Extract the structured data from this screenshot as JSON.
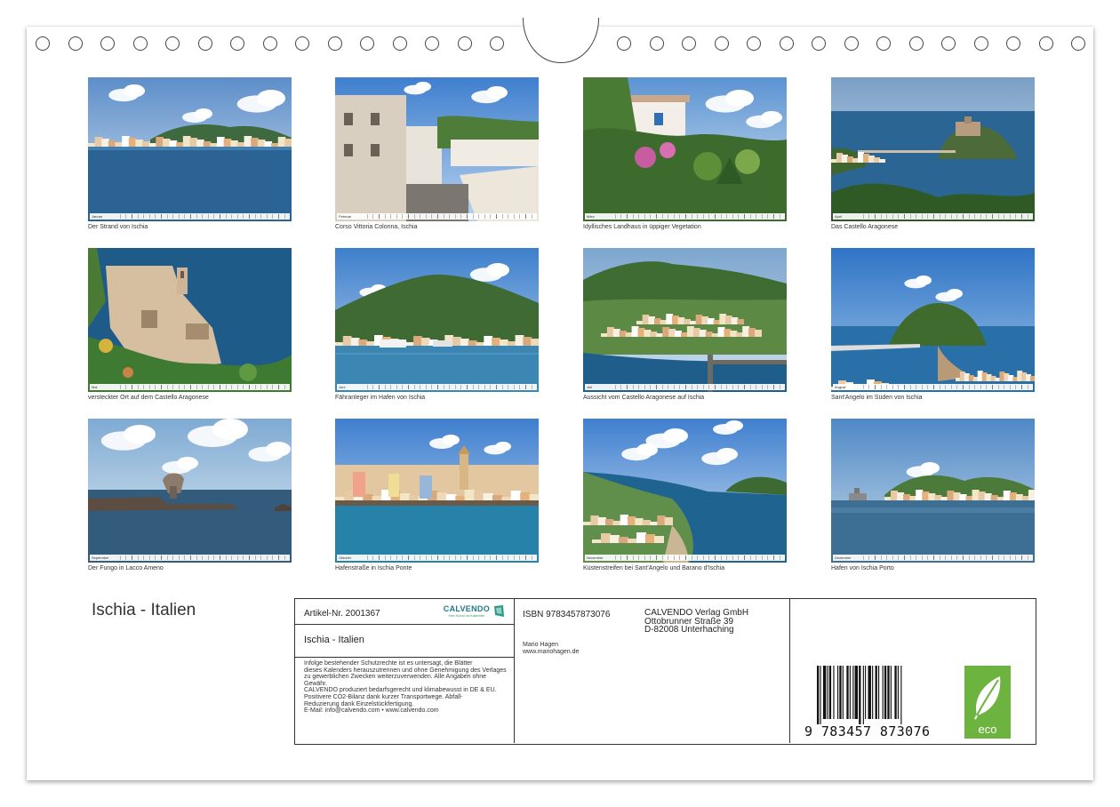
{
  "calendar": {
    "title": "Ischia - Italien",
    "months": [
      {
        "month": "Januar",
        "caption": "Der Strand von Ischia",
        "scene": "bay"
      },
      {
        "month": "Februar",
        "caption": "Corso Vittoria Colonna, Ischia",
        "scene": "street"
      },
      {
        "month": "März",
        "caption": "Idyllisches Landhaus in üppiger Vegetation",
        "scene": "garden"
      },
      {
        "month": "April",
        "caption": "Das Castello Aragonese",
        "scene": "castle"
      },
      {
        "month": "Mai",
        "caption": "versteckter Ort auf dem Castello Aragonese",
        "scene": "ruin"
      },
      {
        "month": "Juni",
        "caption": "Fähranleger im Hafen von Ischia",
        "scene": "harbor"
      },
      {
        "month": "Juli",
        "caption": "Aussicht vom Castello Aragonese auf Ischia",
        "scene": "town"
      },
      {
        "month": "August",
        "caption": "Sant'Angelo im Süden von Ischia",
        "scene": "santangelo"
      },
      {
        "month": "September",
        "caption": "Der Fungo in Lacco Ameno",
        "scene": "fungo"
      },
      {
        "month": "Oktober",
        "caption": "Hafenstraße in Ischia Ponte",
        "scene": "ponte"
      },
      {
        "month": "November",
        "caption": "Küstenstreifen bei Sant'Angelo und Barano d'Ischia",
        "scene": "coast"
      },
      {
        "month": "Dezember",
        "caption": "Hafen von Ischia Porto",
        "scene": "porto"
      }
    ]
  },
  "info": {
    "article": "Artikel-Nr. 2001367",
    "brand": "CALVENDO",
    "brand_sub": "Ihre Kunst im Kalender",
    "title": "Ischia - Italien",
    "legal": [
      "Infolge bestehender Schutzrechte ist es untersagt, die Blätter",
      "dieses Kalenders herauszutrennen und ohne Genehmigung des Verlages",
      "zu gewerblichen Zwecken weiterzuverwenden. Alle Angaben ohne",
      "Gewähr.",
      "CALVENDO produziert bedarfsgerecht und klimabewusst in DE & EU.",
      "Positivere CO2-Bilanz dank kurzer Transportwege. Abfall-",
      "Reduzierung dank Einzelstückfertigung.",
      "E-Mail: info@calvendo.com • www.calvendo.com"
    ],
    "isbn": "ISBN 9783457873076",
    "publisher": [
      "CALVENDO Verlag GmbH",
      "Ottobrunner Straße 39",
      "D-82008 Unterhaching"
    ],
    "author": [
      "Mario Hagen",
      "www.mariohagen.de"
    ],
    "barcode_digits": "9 783457 873076",
    "eco_label": "eco"
  },
  "colors": {
    "sky": "#4a86c8",
    "sea": "#1f5d8a",
    "vegetation": "#3d6b2e",
    "eco_green": "#6db33f",
    "brand_teal": "#1e7a86"
  }
}
